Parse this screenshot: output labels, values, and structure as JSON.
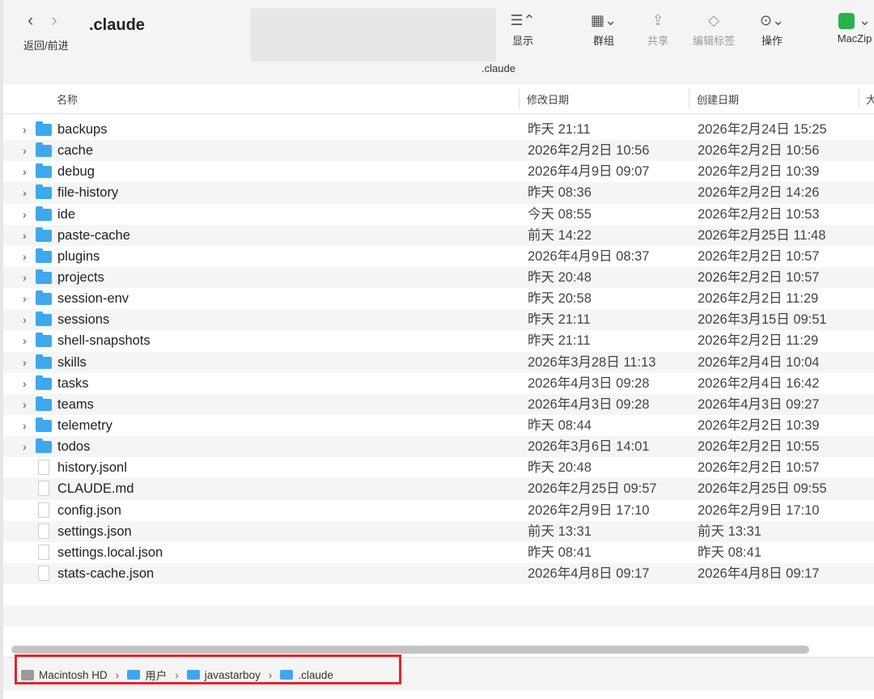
{
  "window": {
    "title": ".claude",
    "subtitle": ".claude"
  },
  "nav": {
    "back_glyph": "‹",
    "forward_glyph": "›",
    "label": "返回/前进"
  },
  "toolbar": {
    "view": {
      "icon": "list-view-icon",
      "label": "显示"
    },
    "group": {
      "icon": "grid-group-icon",
      "label": "群组"
    },
    "share": {
      "icon": "share-icon",
      "label": "共享"
    },
    "tags": {
      "icon": "tag-icon",
      "label": "编辑标签"
    },
    "action": {
      "icon": "ellipsis-circle-icon",
      "label": "操作"
    },
    "maczip": {
      "icon": "maczip-icon",
      "label": "MacZip",
      "color": "#27b34b"
    }
  },
  "columns": {
    "name": "名称",
    "modified": "修改日期",
    "created": "创建日期",
    "size": "大"
  },
  "files": [
    {
      "name": "backups",
      "kind": "folder",
      "modified": "昨天 21:11",
      "created": "2026年2月24日 15:25"
    },
    {
      "name": "cache",
      "kind": "folder",
      "modified": "2026年2月2日 10:56",
      "created": "2026年2月2日 10:56"
    },
    {
      "name": "debug",
      "kind": "folder",
      "modified": "2026年4月9日 09:07",
      "created": "2026年2月2日 10:39"
    },
    {
      "name": "file-history",
      "kind": "folder",
      "modified": "昨天 08:36",
      "created": "2026年2月2日 14:26"
    },
    {
      "name": "ide",
      "kind": "folder",
      "modified": "今天 08:55",
      "created": "2026年2月2日 10:53"
    },
    {
      "name": "paste-cache",
      "kind": "folder",
      "modified": "前天 14:22",
      "created": "2026年2月25日 11:48"
    },
    {
      "name": "plugins",
      "kind": "folder",
      "modified": "2026年4月9日 08:37",
      "created": "2026年2月2日 10:57"
    },
    {
      "name": "projects",
      "kind": "folder",
      "modified": "昨天 20:48",
      "created": "2026年2月2日 10:57"
    },
    {
      "name": "session-env",
      "kind": "folder",
      "modified": "昨天 20:58",
      "created": "2026年2月2日 11:29"
    },
    {
      "name": "sessions",
      "kind": "folder",
      "modified": "昨天 21:11",
      "created": "2026年3月15日 09:51"
    },
    {
      "name": "shell-snapshots",
      "kind": "folder",
      "modified": "昨天 21:11",
      "created": "2026年2月2日 11:29"
    },
    {
      "name": "skills",
      "kind": "folder",
      "modified": "2026年3月28日 11:13",
      "created": "2026年2月4日 10:04"
    },
    {
      "name": "tasks",
      "kind": "folder",
      "modified": "2026年4月3日 09:28",
      "created": "2026年2月4日 16:42"
    },
    {
      "name": "teams",
      "kind": "folder",
      "modified": "2026年4月3日 09:28",
      "created": "2026年4月3日 09:27"
    },
    {
      "name": "telemetry",
      "kind": "folder",
      "modified": "昨天 08:44",
      "created": "2026年2月2日 10:39"
    },
    {
      "name": "todos",
      "kind": "folder",
      "modified": "2026年3月6日 14:01",
      "created": "2026年2月2日 10:55"
    },
    {
      "name": "history.jsonl",
      "kind": "file",
      "modified": "昨天 20:48",
      "created": "2026年2月2日 10:57"
    },
    {
      "name": "CLAUDE.md",
      "kind": "file",
      "modified": "2026年2月25日 09:57",
      "created": "2026年2月25日 09:55"
    },
    {
      "name": "config.json",
      "kind": "file",
      "modified": "2026年2月9日 17:10",
      "created": "2026年2月9日 17:10"
    },
    {
      "name": "settings.json",
      "kind": "file",
      "modified": "前天 13:31",
      "created": "前天 13:31"
    },
    {
      "name": "settings.local.json",
      "kind": "file",
      "modified": "昨天 08:41",
      "created": "昨天 08:41"
    },
    {
      "name": "stats-cache.json",
      "kind": "file",
      "modified": "2026年4月8日 09:17",
      "created": "2026年4月8日 09:17"
    }
  ],
  "pathbar": {
    "items": [
      {
        "label": "Macintosh HD",
        "icon": "hard-drive-icon"
      },
      {
        "label": "用户",
        "icon": "folder-icon"
      },
      {
        "label": "javastarboy",
        "icon": "home-folder-icon"
      },
      {
        "label": ".claude",
        "icon": "folder-icon"
      }
    ],
    "separator": "›",
    "highlight_color": "#e0262d"
  }
}
